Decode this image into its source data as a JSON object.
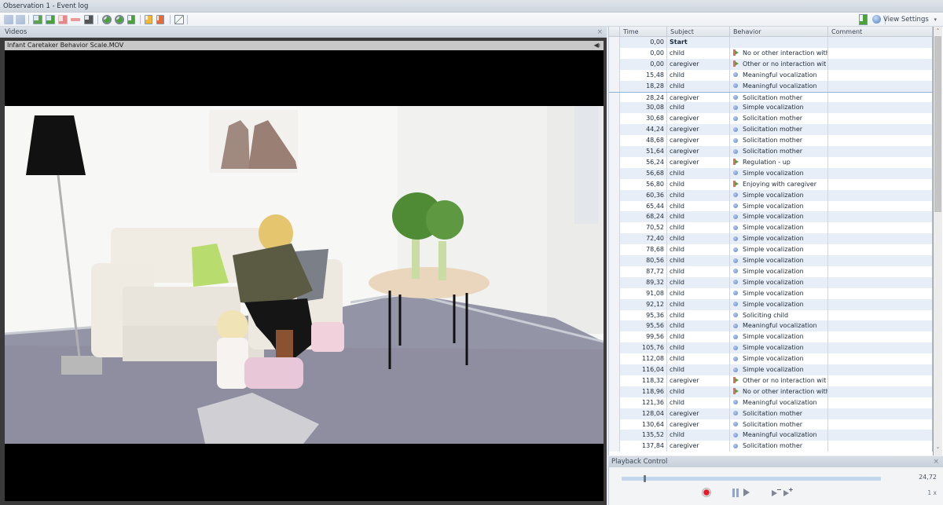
{
  "window": {
    "title": "Observation 1 - Event log"
  },
  "toolbar": {
    "buttons": [
      "undo-icon",
      "redo-icon",
      "accept-event-icon",
      "insert-event-icon",
      "delete-event-icon",
      "remove-icon",
      "find-icon",
      "add-observation-icon",
      "edit-observation-icon",
      "add-document-icon",
      "lightbulb-document-icon",
      "export-document-icon",
      "chart-icon"
    ],
    "right": {
      "export_icon": "export-icon",
      "help_icon": "help-icon",
      "view_settings_label": "View Settings",
      "view_settings_arrow": "▾"
    }
  },
  "videos_panel": {
    "title": "Videos",
    "close": "×",
    "filename": "Infant Caretaker Behavior Scale.MOV",
    "volume_icon": "◀ı"
  },
  "event_table": {
    "columns": [
      "Time",
      "Subject",
      "Behavior",
      "Comment"
    ],
    "rows": [
      {
        "time": "0,00",
        "subject": "Start",
        "behavior": "",
        "icon": "",
        "bold": true
      },
      {
        "time": "0,00",
        "subject": "child",
        "behavior": "No or other interaction with",
        "icon": "state"
      },
      {
        "time": "0,00",
        "subject": "caregiver",
        "behavior": "Other or no interaction wit",
        "icon": "state"
      },
      {
        "time": "15,48",
        "subject": "child",
        "behavior": "Meaningful vocalization",
        "icon": "point"
      },
      {
        "time": "18,28",
        "subject": "child",
        "behavior": "Meaningful vocalization",
        "icon": "point"
      },
      {
        "time": "28,24",
        "subject": "caregiver",
        "behavior": "Solicitation mother",
        "icon": "point",
        "current": true
      },
      {
        "time": "30,08",
        "subject": "child",
        "behavior": "Simple vocalization",
        "icon": "point"
      },
      {
        "time": "30,68",
        "subject": "caregiver",
        "behavior": "Solicitation mother",
        "icon": "point"
      },
      {
        "time": "44,24",
        "subject": "caregiver",
        "behavior": "Solicitation mother",
        "icon": "point"
      },
      {
        "time": "48,68",
        "subject": "caregiver",
        "behavior": "Solicitation mother",
        "icon": "point"
      },
      {
        "time": "51,64",
        "subject": "caregiver",
        "behavior": "Solicitation mother",
        "icon": "point"
      },
      {
        "time": "56,24",
        "subject": "caregiver",
        "behavior": "Regulation - up",
        "icon": "state"
      },
      {
        "time": "56,68",
        "subject": "child",
        "behavior": "Simple vocalization",
        "icon": "point"
      },
      {
        "time": "56,80",
        "subject": "child",
        "behavior": "Enjoying with caregiver",
        "icon": "state"
      },
      {
        "time": "60,36",
        "subject": "child",
        "behavior": "Simple vocalization",
        "icon": "point"
      },
      {
        "time": "65,44",
        "subject": "child",
        "behavior": "Simple vocalization",
        "icon": "point"
      },
      {
        "time": "68,24",
        "subject": "child",
        "behavior": "Simple vocalization",
        "icon": "point"
      },
      {
        "time": "70,52",
        "subject": "child",
        "behavior": "Simple vocalization",
        "icon": "point"
      },
      {
        "time": "72,40",
        "subject": "child",
        "behavior": "Simple vocalization",
        "icon": "point"
      },
      {
        "time": "78,68",
        "subject": "child",
        "behavior": "Simple vocalization",
        "icon": "point"
      },
      {
        "time": "80,56",
        "subject": "child",
        "behavior": "Simple vocalization",
        "icon": "point"
      },
      {
        "time": "87,72",
        "subject": "child",
        "behavior": "Simple vocalization",
        "icon": "point"
      },
      {
        "time": "89,32",
        "subject": "child",
        "behavior": "Simple vocalization",
        "icon": "point"
      },
      {
        "time": "91,08",
        "subject": "child",
        "behavior": "Simple vocalization",
        "icon": "point"
      },
      {
        "time": "92,12",
        "subject": "child",
        "behavior": "Simple vocalization",
        "icon": "point"
      },
      {
        "time": "95,36",
        "subject": "child",
        "behavior": "Soliciting child",
        "icon": "point"
      },
      {
        "time": "95,56",
        "subject": "child",
        "behavior": "Meaningful vocalization",
        "icon": "point"
      },
      {
        "time": "99,56",
        "subject": "child",
        "behavior": "Simple vocalization",
        "icon": "point"
      },
      {
        "time": "105,76",
        "subject": "child",
        "behavior": "Simple vocalization",
        "icon": "point"
      },
      {
        "time": "112,08",
        "subject": "child",
        "behavior": "Simple vocalization",
        "icon": "point"
      },
      {
        "time": "116,04",
        "subject": "child",
        "behavior": "Simple vocalization",
        "icon": "point"
      },
      {
        "time": "118,32",
        "subject": "caregiver",
        "behavior": "Other or no interaction wit",
        "icon": "state"
      },
      {
        "time": "118,96",
        "subject": "child",
        "behavior": "No or other interaction with",
        "icon": "state"
      },
      {
        "time": "121,36",
        "subject": "child",
        "behavior": "Meaningful vocalization",
        "icon": "point"
      },
      {
        "time": "128,04",
        "subject": "caregiver",
        "behavior": "Solicitation mother",
        "icon": "point"
      },
      {
        "time": "130,64",
        "subject": "caregiver",
        "behavior": "Solicitation mother",
        "icon": "point"
      },
      {
        "time": "135,52",
        "subject": "child",
        "behavior": "Meaningful vocalization",
        "icon": "point"
      },
      {
        "time": "137,84",
        "subject": "caregiver",
        "behavior": "Solicitation mother",
        "icon": "point"
      }
    ],
    "scroll": {
      "up": "˄",
      "down": "˅",
      "position_fraction": 0.0,
      "visible_fraction": 0.43
    }
  },
  "playback": {
    "title": "Playback Control",
    "close": "×",
    "current_time": "24,72",
    "progress_fraction": 0.085,
    "speed": "1 x",
    "buttons": [
      "record",
      "pause",
      "play",
      "step-back",
      "step-forward"
    ],
    "step_back_sign": "−",
    "step_forward_sign": "+"
  },
  "colors": {
    "accent": "#8fb3da",
    "row_alt": "#e8eef7",
    "point_event": "#5f85c8",
    "record": "#e8192c"
  }
}
